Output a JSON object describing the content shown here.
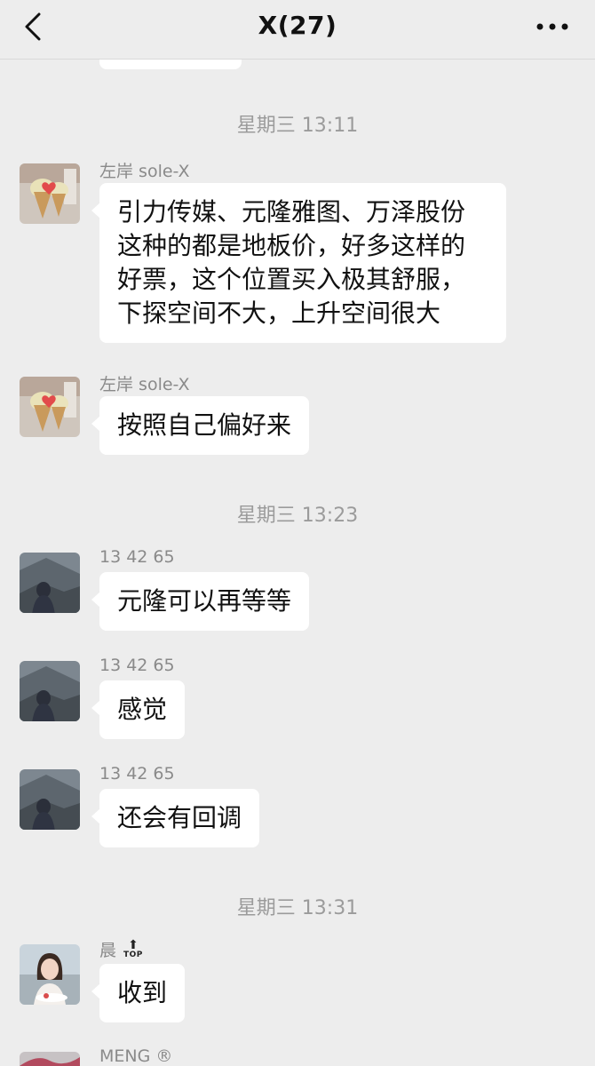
{
  "header": {
    "title": "X(27)",
    "back_icon": "chevron-left-icon",
    "more_icon": "ellipsis-icon"
  },
  "timestamps": {
    "t1": "星期三 13:11",
    "t2": "星期三 13:23",
    "t3": "星期三 13:31"
  },
  "messages": [
    {
      "sender": "左岸 sole-X",
      "text": "引力传媒、元隆雅图、万泽股份这种的都是地板价，好多这样的好票，这个位置买入极其舒服，下探空间不大，上升空间很大"
    },
    {
      "sender": "左岸 sole-X",
      "text": "按照自己偏好来"
    },
    {
      "sender": "13 42 65",
      "text": "元隆可以再等等"
    },
    {
      "sender": "13 42 65",
      "text": "感觉"
    },
    {
      "sender": "13 42 65",
      "text": "还会有回调"
    },
    {
      "sender": "晨",
      "badge": "TOP",
      "text": "收到"
    },
    {
      "sender": "MENG ®"
    }
  ]
}
